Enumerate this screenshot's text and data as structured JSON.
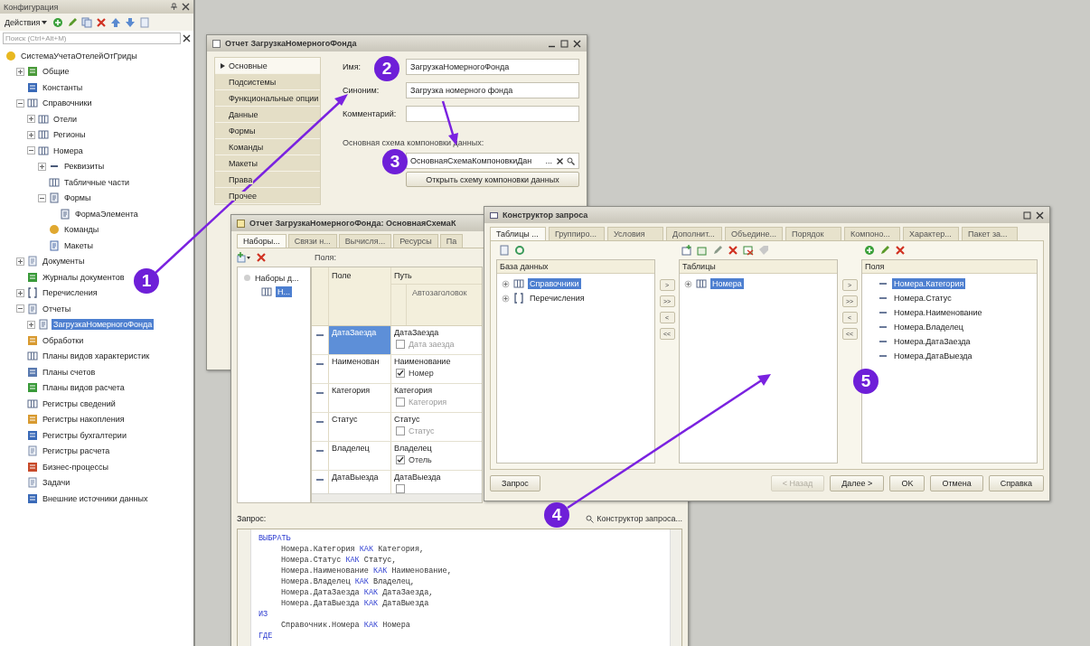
{
  "config_panel": {
    "title": "Конфигурация",
    "actions_label": "Действия",
    "search": {
      "placeholder": "Поиск (Ctrl+Alt+M)"
    },
    "tree": [
      {
        "label": "СистемаУчетаОтелейОтГриды",
        "kind": "root",
        "selected": false,
        "children": [
          {
            "label": "Общие",
            "kind": "common",
            "expanded": false,
            "selected": false
          },
          {
            "label": "Константы",
            "kind": "constant",
            "selected": false
          },
          {
            "label": "Справочники",
            "kind": "catalog",
            "expanded": true,
            "selected": false,
            "children": [
              {
                "label": "Отели",
                "kind": "catalog",
                "expanded": false,
                "selected": false
              },
              {
                "label": "Регионы",
                "kind": "catalog",
                "expanded": false,
                "selected": false
              },
              {
                "label": "Номера",
                "kind": "catalog",
                "expanded": true,
                "selected": false,
                "children": [
                  {
                    "label": "Реквизиты",
                    "kind": "attribute",
                    "expanded": false,
                    "selected": false
                  },
                  {
                    "label": "Табличные части",
                    "kind": "catalog",
                    "selected": false
                  },
                  {
                    "label": "Формы",
                    "kind": "form",
                    "expanded": true,
                    "selected": false,
                    "children": [
                      {
                        "label": "ФормаЭлемента",
                        "kind": "form",
                        "selected": false
                      }
                    ]
                  },
                  {
                    "label": "Команды",
                    "kind": "command",
                    "selected": false
                  },
                  {
                    "label": "Макеты",
                    "kind": "template",
                    "selected": false
                  }
                ]
              }
            ]
          },
          {
            "label": "Документы",
            "kind": "document",
            "expanded": false,
            "selected": false
          },
          {
            "label": "Журналы документов",
            "kind": "journal",
            "selected": false
          },
          {
            "label": "Перечисления",
            "kind": "enum",
            "expanded": false,
            "selected": false
          },
          {
            "label": "Отчеты",
            "kind": "report",
            "expanded": true,
            "selected": false,
            "children": [
              {
                "label": "ЗагрузкаНомерногоФонда",
                "kind": "report",
                "expanded": false,
                "selected": true
              }
            ]
          },
          {
            "label": "Обработки",
            "kind": "processing",
            "selected": false
          },
          {
            "label": "Планы видов характеристик",
            "kind": "catalog",
            "selected": false
          },
          {
            "label": "Планы счетов",
            "kind": "accounts",
            "selected": false
          },
          {
            "label": "Планы видов расчета",
            "kind": "journal",
            "selected": false
          },
          {
            "label": "Регистры сведений",
            "kind": "catalog",
            "selected": false
          },
          {
            "label": "Регистры накопления",
            "kind": "processing",
            "selected": false
          },
          {
            "label": "Регистры бухгалтерии",
            "kind": "constant",
            "selected": false
          },
          {
            "label": "Регистры расчета",
            "kind": "document",
            "selected": false
          },
          {
            "label": "Бизнес-процессы",
            "kind": "business",
            "selected": false
          },
          {
            "label": "Задачи",
            "kind": "document",
            "selected": false
          },
          {
            "label": "Внешние источники данных",
            "kind": "constant",
            "selected": false
          }
        ]
      }
    ]
  },
  "report_window": {
    "title": "Отчет ЗагрузкаНомерногоФонда",
    "nav": [
      {
        "label": "Основные",
        "selected": true
      },
      {
        "label": "Подсистемы",
        "selected": false
      },
      {
        "label": "Функциональные опции",
        "selected": false
      },
      {
        "label": "Данные",
        "selected": false
      },
      {
        "label": "Формы",
        "selected": false
      },
      {
        "label": "Команды",
        "selected": false
      },
      {
        "label": "Макеты",
        "selected": false
      },
      {
        "label": "Права",
        "selected": false
      },
      {
        "label": "Прочее",
        "selected": false
      }
    ],
    "fields": [
      {
        "label": "Имя:",
        "value": "ЗагрузкаНомерногоФонда"
      },
      {
        "label": "Синоним:",
        "value": "Загрузка номерного фонда"
      },
      {
        "label": "Комментарий:"
      }
    ],
    "schema_label": "Основная схема компоновки данных:",
    "schema_field": {
      "value": "ОсновнаяСхемаКомпоновкиДан",
      "select_button": "..."
    },
    "open_button": "Открыть схему компоновки данных"
  },
  "schema_window": {
    "title": "Отчет ЗагрузкаНомерногоФонда: ОсновнаяСхемаК",
    "tabs": [
      {
        "label": "Наборы...",
        "selected": true
      },
      {
        "label": "Связи н...",
        "selected": false
      },
      {
        "label": "Вычисля...",
        "selected": false
      },
      {
        "label": "Ресурсы",
        "selected": false
      },
      {
        "label": "Па",
        "selected": false
      }
    ],
    "datasets": {
      "label": "Наборы д...",
      "children": [
        {
          "label": "Н...",
          "selected": true
        }
      ]
    },
    "fields_label": "Поля:",
    "columns": [
      "Поле",
      "Путь"
    ],
    "subheader": "Автозаголовок",
    "rows": [
      {
        "field": "ДатаЗаезда",
        "path": "ДатаЗаезда",
        "checked": false,
        "title": "Дата заезда",
        "selected": true
      },
      {
        "field": "Наименован",
        "path": "Наименование",
        "checked": true,
        "title": "Номер",
        "selected": false
      },
      {
        "field": "Категория",
        "path": "Категория",
        "checked": false,
        "title": "Категория",
        "selected": false
      },
      {
        "field": "Статус",
        "path": "Статус",
        "checked": false,
        "title": "Статус",
        "selected": false
      },
      {
        "field": "Владелец",
        "path": "Владелец",
        "checked": true,
        "title": "Отель",
        "selected": false
      },
      {
        "field": "ДатаВыезда",
        "path": "ДатаВыезда",
        "checked": false,
        "selected": false
      }
    ],
    "query_label": "Запрос:",
    "builder_link": "Конструктор запроса...",
    "query_lines": [
      {
        "indented": false,
        "parts": [
          {
            "text": "ВЫБРАТЬ",
            "kind": "keyword"
          }
        ]
      },
      {
        "indented": true,
        "parts": [
          {
            "text": "Номера.Категория ",
            "kind": "text"
          },
          {
            "text": "КАК",
            "kind": "keyword"
          },
          {
            "text": " Категория,",
            "kind": "text"
          }
        ]
      },
      {
        "indented": true,
        "parts": [
          {
            "text": "Номера.Статус ",
            "kind": "text"
          },
          {
            "text": "КАК",
            "kind": "keyword"
          },
          {
            "text": " Статус,",
            "kind": "text"
          }
        ]
      },
      {
        "indented": true,
        "parts": [
          {
            "text": "Номера.Наименование ",
            "kind": "text"
          },
          {
            "text": "КАК",
            "kind": "keyword"
          },
          {
            "text": " Наименование,",
            "kind": "text"
          }
        ]
      },
      {
        "indented": true,
        "parts": [
          {
            "text": "Номера.Владелец ",
            "kind": "text"
          },
          {
            "text": "КАК",
            "kind": "keyword"
          },
          {
            "text": " Владелец,",
            "kind": "text"
          }
        ]
      },
      {
        "indented": true,
        "parts": [
          {
            "text": "Номера.ДатаЗаезда ",
            "kind": "text"
          },
          {
            "text": "КАК",
            "kind": "keyword"
          },
          {
            "text": " ДатаЗаезда,",
            "kind": "text"
          }
        ]
      },
      {
        "indented": true,
        "parts": [
          {
            "text": "Номера.ДатаВыезда ",
            "kind": "text"
          },
          {
            "text": "КАК",
            "kind": "keyword"
          },
          {
            "text": " ДатаВыезда",
            "kind": "text"
          }
        ]
      },
      {
        "indented": false,
        "parts": [
          {
            "text": "ИЗ",
            "kind": "keyword"
          }
        ]
      },
      {
        "indented": true,
        "parts": [
          {
            "text": "Справочник.Номера ",
            "kind": "text"
          },
          {
            "text": "КАК",
            "kind": "keyword"
          },
          {
            "text": " Номера",
            "kind": "text"
          }
        ]
      },
      {
        "indented": false,
        "parts": [
          {
            "text": "ГДЕ",
            "kind": "keyword"
          }
        ]
      }
    ]
  },
  "query_builder": {
    "title": "Конструктор запроса",
    "tabs": [
      {
        "label": "Таблицы ...",
        "selected": true
      },
      {
        "label": "Группиро...",
        "selected": false
      },
      {
        "label": "Условия",
        "selected": false
      },
      {
        "label": "Дополнит...",
        "selected": false
      },
      {
        "label": "Объедине...",
        "selected": false
      },
      {
        "label": "Порядок",
        "selected": false
      },
      {
        "label": "Компоно...",
        "selected": false
      },
      {
        "label": "Характер...",
        "selected": false
      },
      {
        "label": "Пакет за...",
        "selected": false
      }
    ],
    "panels": [
      {
        "title": "База данных",
        "items": [
          {
            "label": "Справочники",
            "kind": "catalog",
            "expanded": false,
            "selected": true
          },
          {
            "label": "Перечисления",
            "kind": "enum",
            "expanded": false,
            "selected": false
          }
        ],
        "move_buttons": [
          ">",
          ">>",
          "<",
          "<<"
        ]
      },
      {
        "title": "Таблицы",
        "items": [
          {
            "label": "Номера",
            "kind": "catalog",
            "expanded": false,
            "selected": true
          }
        ],
        "move_buttons": [
          ">",
          ">>",
          "<",
          "<<"
        ]
      },
      {
        "title": "Поля",
        "items": [
          {
            "label": "Номера.Категория",
            "kind": "field",
            "selected": true
          },
          {
            "label": "Номера.Статус",
            "kind": "field",
            "selected": false
          },
          {
            "label": "Номера.Наименование",
            "kind": "field",
            "selected": false
          },
          {
            "label": "Номера.Владелец",
            "kind": "field",
            "selected": false
          },
          {
            "label": "Номера.ДатаЗаезда",
            "kind": "field",
            "selected": false
          },
          {
            "label": "Номера.ДатаВыезда",
            "kind": "field",
            "selected": false
          }
        ]
      }
    ],
    "bottom_buttons": [
      {
        "label": "Запрос",
        "disabled": false
      },
      {
        "label": "< Назад",
        "disabled": true
      },
      {
        "label": "Далее >",
        "disabled": false
      },
      {
        "label": "OK",
        "disabled": false
      },
      {
        "label": "Отмена",
        "disabled": false
      },
      {
        "label": "Справка",
        "disabled": false
      }
    ]
  },
  "annotations": [
    {
      "label": "1"
    },
    {
      "label": "2"
    },
    {
      "label": "3"
    },
    {
      "label": "4"
    },
    {
      "label": "5"
    }
  ]
}
